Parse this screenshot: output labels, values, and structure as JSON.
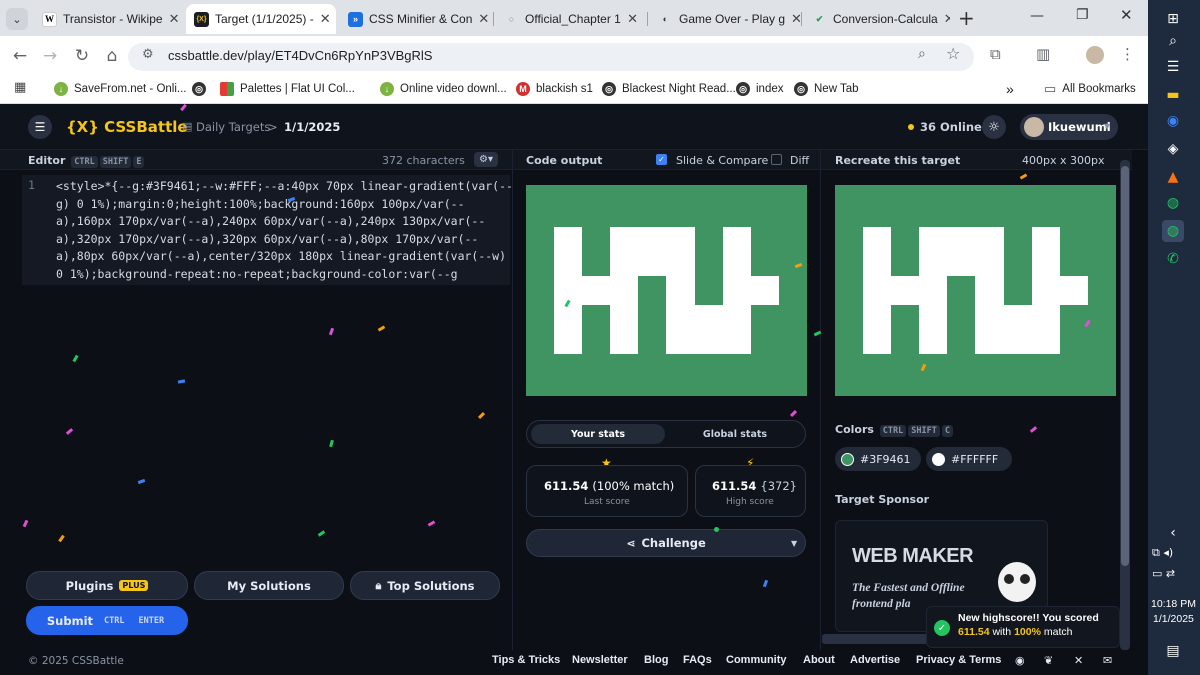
{
  "browser": {
    "tabs": [
      {
        "title": "Transistor - Wikipe",
        "fav": "W"
      },
      {
        "title": "Target (1/1/2025) -",
        "fav": "{X}"
      },
      {
        "title": "CSS Minifier & Con",
        "fav": "»"
      },
      {
        "title": "Official_Chapter 1",
        "fav": "○"
      },
      {
        "title": "Game Over - Play g",
        "fav": "◐"
      },
      {
        "title": "Conversion-Calcula",
        "fav": "✔"
      }
    ],
    "new_tab": "+",
    "url": "cssbattle.dev/play/ET4DvCn6RpYnP3VBgRlS",
    "bookmarks": [
      {
        "label": "SaveFrom.net - Onli...",
        "color": "#7cb342"
      },
      {
        "label": "",
        "color": "#333"
      },
      {
        "label": "Palettes | Flat UI Col...",
        "color": "#e53935"
      },
      {
        "label": "Online video downl...",
        "color": "#7cb342"
      },
      {
        "label": "blackish s1",
        "color": "#d32f2f"
      },
      {
        "label": "Blackest Night Read...",
        "color": "#333"
      },
      {
        "label": "index",
        "color": "#333"
      },
      {
        "label": "New Tab",
        "color": "#333"
      }
    ],
    "bookmarks_more": "»",
    "all_bookmarks": "All Bookmarks"
  },
  "app": {
    "logo": "{X} CSSBattle",
    "breadcrumb_daily": "Daily Targets",
    "breadcrumb_sep": ">",
    "breadcrumb_date": "1/1/2025",
    "online": "36 Online",
    "username": "Ikuewuml"
  },
  "editor": {
    "label": "Editor",
    "shortcut": [
      "CTRL",
      "SHIFT",
      "E"
    ],
    "chars": "372 characters",
    "line_no": "1",
    "code_lines": [
      "<style>*{--g:#3F9461;--w:#FFF;--a:40px 70px linear-gradient(var(--",
      "g) 0 1%);margin:0;height:100%;background:160px 100px/var(--",
      "a),160px 170px/var(--a),240px 60px/var(--a),240px 130px/var(--",
      "a),320px 170px/var(--a),320px 60px/var(--a),80px 170px/var(--",
      "a),80px 60px/var(--a),center/320px 180px linear-gradient(var(--w)",
      "0 1%);background-repeat:no-repeat;background-color:var(--g"
    ]
  },
  "output": {
    "label": "Code output",
    "slide_compare": "Slide & Compare",
    "diff": "Diff",
    "stats_tabs": [
      "Your stats",
      "Global stats"
    ],
    "last_score": "611.54",
    "last_match": "(100% match)",
    "last_label": "Last score",
    "high_score": "611.54",
    "high_chars": "{372}",
    "high_label": "High score",
    "challenge": "Challenge"
  },
  "target": {
    "label": "Recreate this target",
    "size": "400px x 300px",
    "colors_label": "Colors",
    "colors_shortcut": [
      "CTRL",
      "SHIFT",
      "C"
    ],
    "colors": [
      "#3F9461",
      "#FFFFFF"
    ],
    "sponsor_label": "Target Sponsor",
    "sponsor_name": "WEB MAKER",
    "sponsor_tagline_1": "The Fastest and Offline",
    "sponsor_tagline_2": "frontend pla"
  },
  "buttons": {
    "plugins": "Plugins",
    "plugins_badge": "PLUS",
    "my_solutions": "My Solutions",
    "top_solutions": "Top Solutions",
    "submit": "Submit",
    "submit_shortcut": [
      "CTRL",
      "ENTER"
    ]
  },
  "toast": {
    "line1": "New highscore!! You scored",
    "score": "611.54",
    "with": "with",
    "match": "100%",
    "match_word": "match"
  },
  "footer": {
    "copyright": "© 2025 CSSBattle",
    "links": [
      "Tips & Tricks",
      "Newsletter",
      "Blog",
      "FAQs",
      "Community",
      "About",
      "Advertise",
      "Privacy & Terms"
    ]
  },
  "taskbar": {
    "time": "10:18 PM",
    "date": "1/1/2025"
  }
}
